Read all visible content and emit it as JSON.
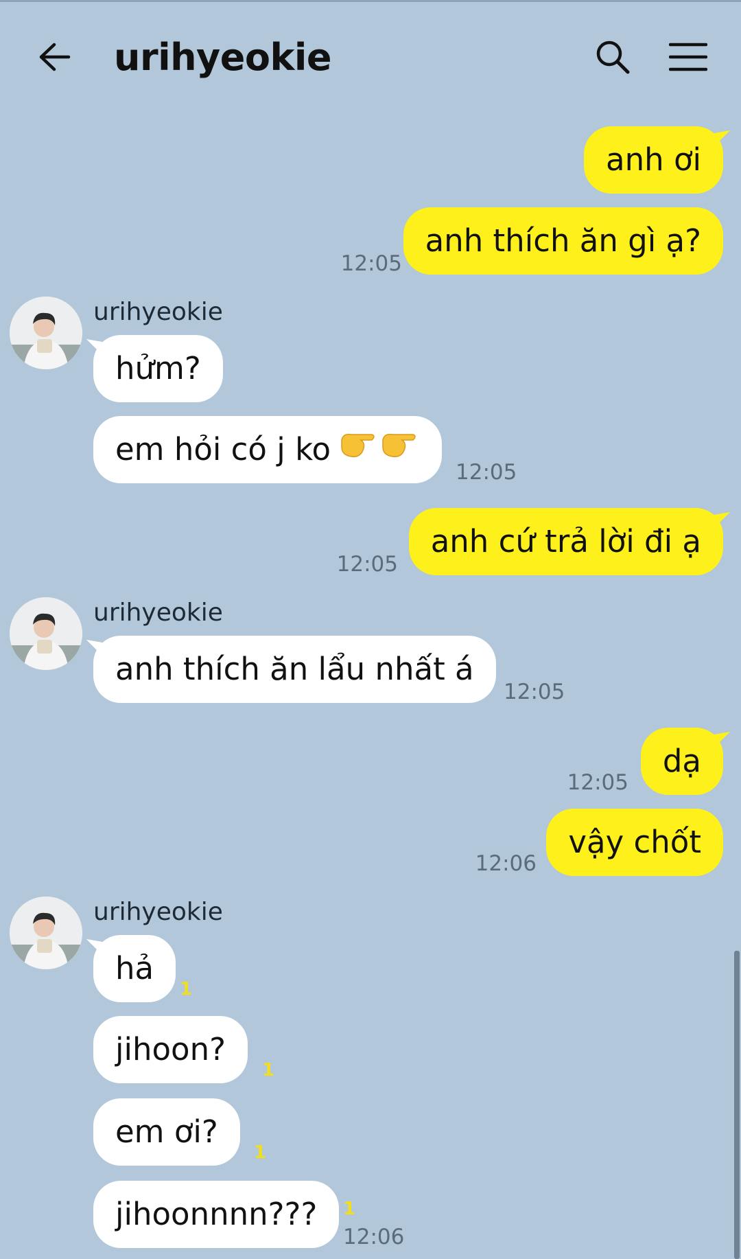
{
  "header": {
    "title": "urihyeokie",
    "back_icon": "arrow-left-icon",
    "search_icon": "search-icon",
    "menu_icon": "hamburger-menu-icon"
  },
  "colors": {
    "background": "#b2c7da",
    "my_bubble": "#fef01b",
    "their_bubble": "#ffffff",
    "unread": "#f1dd21"
  },
  "messages": [
    {
      "from": "me",
      "text": "anh ơi"
    },
    {
      "from": "me",
      "text": "anh thích ăn gì ạ?",
      "time": "12:05"
    },
    {
      "from": "them",
      "sender": "urihyeokie",
      "text": "hửm?"
    },
    {
      "from": "them",
      "text": "em hỏi có j ko",
      "emoji": "pointing-hands-emoji",
      "time": "12:05"
    },
    {
      "from": "me",
      "text": "anh cứ trả lời đi ạ",
      "time": "12:05"
    },
    {
      "from": "them",
      "sender": "urihyeokie",
      "text": "anh thích ăn lẩu nhất á",
      "time": "12:05"
    },
    {
      "from": "me",
      "text": "dạ",
      "time": "12:05"
    },
    {
      "from": "me",
      "text": "vậy chốt",
      "time": "12:06"
    },
    {
      "from": "them",
      "sender": "urihyeokie",
      "text": "hả",
      "unread": "1"
    },
    {
      "from": "them",
      "text": "jihoon?",
      "unread": "1"
    },
    {
      "from": "them",
      "text": "em ơi?",
      "unread": "1"
    },
    {
      "from": "them",
      "text": "jihoonnnn???",
      "unread": "1",
      "time": "12:06"
    }
  ]
}
